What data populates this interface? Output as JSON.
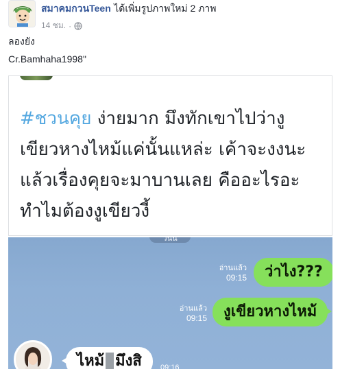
{
  "post": {
    "page_name": "สมาคมกวนTeen",
    "action": "ได้เพิ่มรูปภาพใหม่ 2 ภาพ",
    "time": "14 ชม.",
    "dot": "·",
    "privacy_icon": "globe-icon"
  },
  "caption": {
    "line1": "ลองยัง",
    "line2": "Cr.Bamhaha1998\""
  },
  "image_top": {
    "hashtag": "#ชวนคุย",
    "line1_rest": " ง่ายมาก มึงทักเขาไปว่างู",
    "line2": "เขียวหางไหม้แค่นั้นแหล่ะ เค้าจะงงนะ",
    "line3": "แล้วเรื่องคุยจะมาบานเลย คืออะไรอะ",
    "line4": "ทำไมต้องงูเขียวงี้"
  },
  "image_bottom": {
    "date_chip": "วันนี้",
    "messages": [
      {
        "text": "ว่าไง???",
        "read": "อ่านแล้ว",
        "time": "09:15"
      },
      {
        "text": "งูเขียวหางไหม้",
        "read": "อ่านแล้ว",
        "time": "09:15"
      }
    ],
    "reply_before": "ไหม้",
    "reply_after": "มึงสิ",
    "reply_time": "09:16"
  },
  "colors": {
    "link": "#365899",
    "hashtag": "#55a8e0",
    "line_green": "#86e05b",
    "chat_bg": "#8fb0d6"
  }
}
